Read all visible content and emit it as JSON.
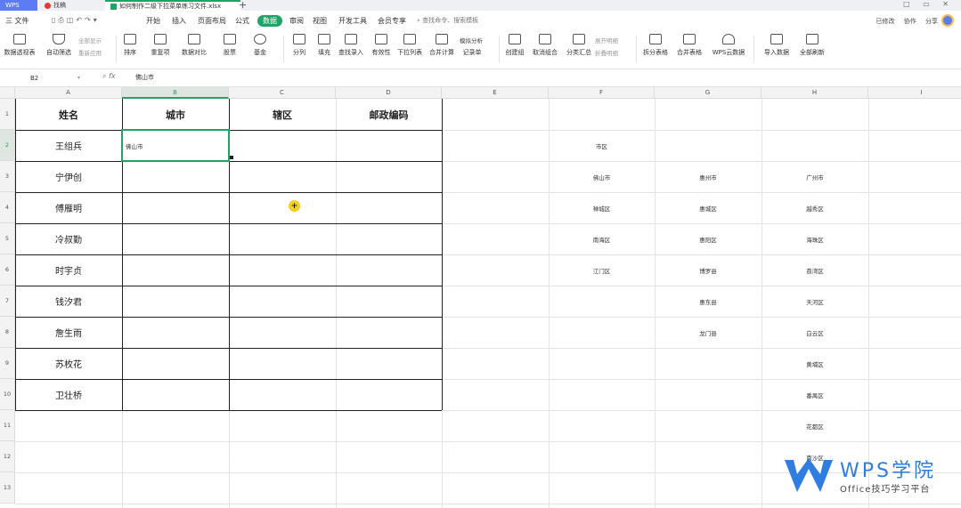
{
  "titlebar": {
    "tabs": [
      {
        "label": "WPS"
      },
      {
        "label": "找稿"
      },
      {
        "label": "如何制作二级下拉菜单练习文件.xlsx"
      }
    ],
    "new_tab": "+",
    "window_controls": "□ ▭ ✕"
  },
  "menu": {
    "items": [
      "三 文件",
      "开始",
      "插入",
      "页面布局",
      "公式",
      "数据",
      "审阅",
      "视图",
      "开发工具",
      "会员专享",
      "查找命令、搜索模板"
    ],
    "active": "数据",
    "right": [
      "已修改",
      "协作",
      "分享"
    ]
  },
  "ribbon": {
    "buttons": [
      {
        "label": "数据透视表"
      },
      {
        "label": "自动筛选"
      },
      {
        "label": "排序"
      },
      {
        "label": "重复项"
      },
      {
        "label": "数据对比"
      },
      {
        "label": "股票"
      },
      {
        "label": "基金"
      },
      {
        "label": "分列"
      },
      {
        "label": "填充"
      },
      {
        "label": "查找录入"
      },
      {
        "label": "有效性"
      },
      {
        "label": "下拉列表"
      },
      {
        "label": "合并计算"
      },
      {
        "label": "记录单"
      },
      {
        "label": "创建组"
      },
      {
        "label": "取消组合"
      },
      {
        "label": "分类汇总"
      },
      {
        "label": "拆分表格"
      },
      {
        "label": "合并表格"
      },
      {
        "label": "WPS云数据"
      },
      {
        "label": "导入数据"
      },
      {
        "label": "全部刷新"
      }
    ],
    "small": {
      "show_all": "全部显示",
      "reapply": "重新应用",
      "simulate": "模拟分析",
      "expand": "展开明细",
      "collapse": "折叠明细"
    }
  },
  "formula_bar": {
    "cell_ref": "B2",
    "fx": "fx",
    "content": "佛山市"
  },
  "grid": {
    "columns": [
      "A",
      "B",
      "C",
      "D",
      "E",
      "F",
      "G",
      "H",
      "I"
    ],
    "rows": [
      "1",
      "2",
      "3",
      "4",
      "5",
      "6",
      "7",
      "8",
      "9",
      "10",
      "11",
      "12",
      "13"
    ],
    "selected_col": "B",
    "selected_row": "2",
    "headers": [
      "姓名",
      "城市",
      "辖区",
      "邮政编码"
    ],
    "names": [
      "王组兵",
      "宁伊创",
      "傅雁明",
      "冷叔勤",
      "时宇贞",
      "钱汐君",
      "詹生雨",
      "苏枚花",
      "卫壮桥"
    ],
    "b2_value": "佛山市",
    "f_list": [
      "市区",
      "佛山市",
      "禅城区",
      "南海区",
      "江门区"
    ],
    "g_list": [
      "惠州市",
      "惠城区",
      "惠阳区",
      "博罗县",
      "惠东县",
      "龙门县"
    ],
    "h_list": [
      "广州市",
      "越秀区",
      "海珠区",
      "荔湾区",
      "天河区",
      "白云区",
      "黄埔区",
      "番禺区",
      "花都区",
      "南沙区"
    ]
  },
  "watermark": {
    "title": "WPS学院",
    "subtitle": "Office技巧学习平台"
  }
}
